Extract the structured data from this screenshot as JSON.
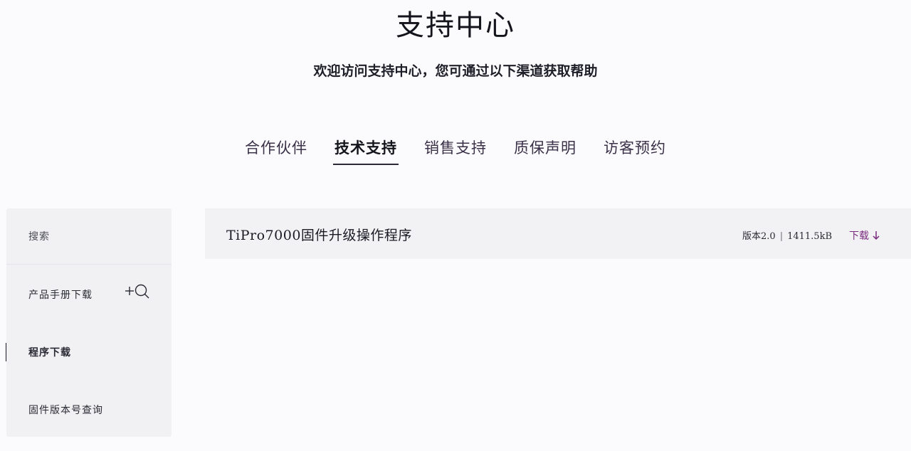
{
  "header": {
    "title": "支持中心",
    "subtitle": "欢迎访问支持中心，您可通过以下渠道获取帮助"
  },
  "tabs": [
    {
      "label": "合作伙伴",
      "active": false
    },
    {
      "label": "技术支持",
      "active": true
    },
    {
      "label": "销售支持",
      "active": false
    },
    {
      "label": "质保声明",
      "active": false
    },
    {
      "label": "访客预约",
      "active": false
    }
  ],
  "sidebar": {
    "search_label": "搜索",
    "items": [
      {
        "label": "产品手册下载",
        "icon": "plus-search-icon"
      },
      {
        "label": "程序下载",
        "active": true
      },
      {
        "label": "固件版本号查询"
      }
    ]
  },
  "files": [
    {
      "name": "TiPro7000固件升级操作程序",
      "version": "版本2.0",
      "separator": "|",
      "size": "1411.5kB",
      "download_label": "下载"
    }
  ],
  "colors": {
    "background": "#fbfbfd",
    "panel": "#f1f1f4",
    "accent": "#7a2a7e",
    "text": "#1a1a24"
  }
}
